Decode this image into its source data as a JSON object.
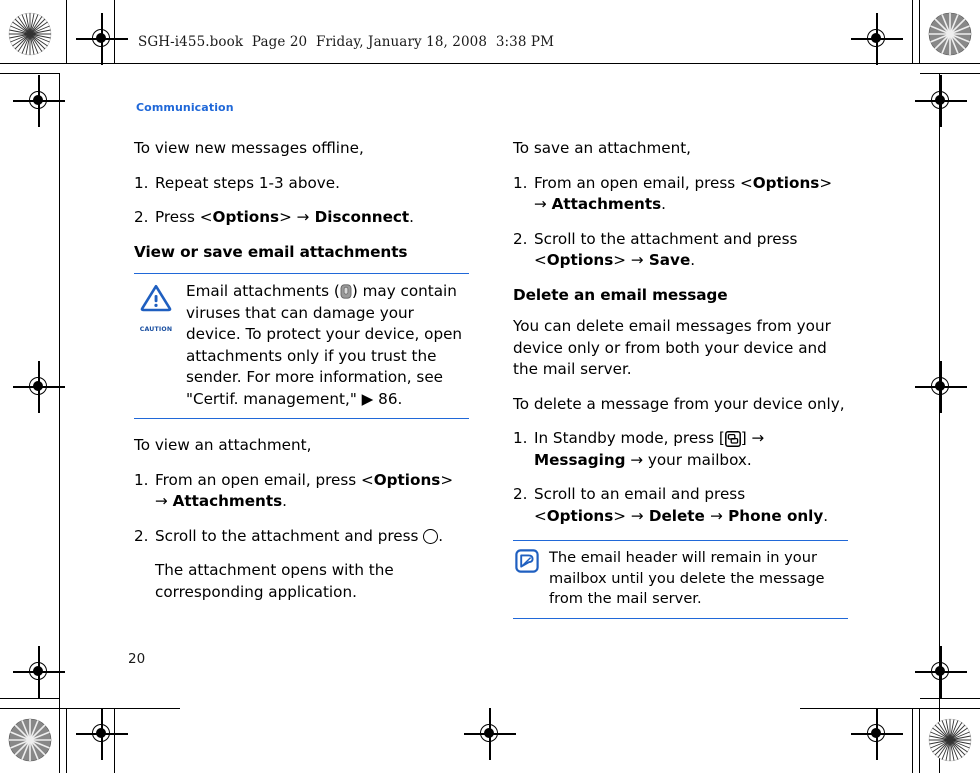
{
  "book_header": {
    "text": "SGH-i455.book  Page 20  Friday, January 18, 2008  3:38 PM"
  },
  "page_title": "Communication",
  "page_number": "20",
  "colors": {
    "accent": "#2068d8",
    "text": "#000000",
    "caution_label": "#1a4fa0",
    "clip_icon": "#8c8c8c"
  },
  "left_column": {
    "intro": "To view new messages offline,",
    "steps": [
      {
        "num": "1.",
        "text": "Repeat steps 1-3 above."
      },
      {
        "num": "2.",
        "pre": "Press <",
        "bold1": "Options",
        "mid": "> ",
        "arrow": "→",
        "bold2": " Disconnect",
        "post": "."
      }
    ],
    "subheading": "View or save email attachments",
    "caution": {
      "icon_name": "caution-icon",
      "label": "CAUTION",
      "text_before_icon": "Email attachments (",
      "inline_icon": "attachment-clip-icon",
      "text_after_icon": ") may contain viruses that can damage your device. To protect your device, open attachments only if you trust the sender. For more information, see \"Certif. management,\"",
      "ref_arrow": "▶",
      "ref_page": "86."
    },
    "intro2": "To view an attachment,",
    "steps2": [
      {
        "num": "1.",
        "line1_pre": "From an open email, press <",
        "line1_bold": "Options",
        "line1_post": ">",
        "line2_arrow": "→",
        "line2_bold": "Attachments",
        "line2_post": "."
      },
      {
        "num": "2.",
        "text_pre": "Scroll to the attachment and press ",
        "key_icon": "circle-confirm-key-icon",
        "text_post": "."
      }
    ],
    "result_text": "The attachment opens with the corresponding application."
  },
  "right_column": {
    "intro": "To save an attachment,",
    "steps": [
      {
        "num": "1.",
        "line1_pre": "From an open email, press <",
        "line1_bold": "Options",
        "line1_post": ">",
        "line2_arrow": "→",
        "line2_bold": "Attachments",
        "line2_post": "."
      },
      {
        "num": "2.",
        "line1": "Scroll to the attachment and press",
        "line2_pre": "<",
        "line2_bold1": "Options",
        "line2_mid": "> ",
        "line2_arrow": "→",
        "line2_bold2": " Save",
        "line2_post": "."
      }
    ],
    "subheading": "Delete an email message",
    "body": "You can delete email messages from your device only or from both your device and the mail server.",
    "intro2": "To delete a message from your device only,",
    "steps2": [
      {
        "num": "1.",
        "line1_pre": "In Standby mode, press [",
        "key_icon": "menu-key-icon",
        "line1_post": "] ",
        "line1_arrow": "→",
        "line2_bold": "Messaging",
        "line2_arrow": "→",
        "line2_post": " your mailbox."
      },
      {
        "num": "2.",
        "line1": "Scroll to an email and press",
        "line2_pre": "<",
        "line2_bold1": "Options",
        "line2_mid": "> ",
        "line2_arrow1": "→",
        "line2_bold2": " Delete ",
        "line2_arrow2": "→",
        "line2_bold3": " Phone only",
        "line2_post": "."
      }
    ],
    "note": {
      "icon_name": "note-pen-icon",
      "text": "The email header will remain in your mailbox until you delete the message from the mail server."
    }
  }
}
